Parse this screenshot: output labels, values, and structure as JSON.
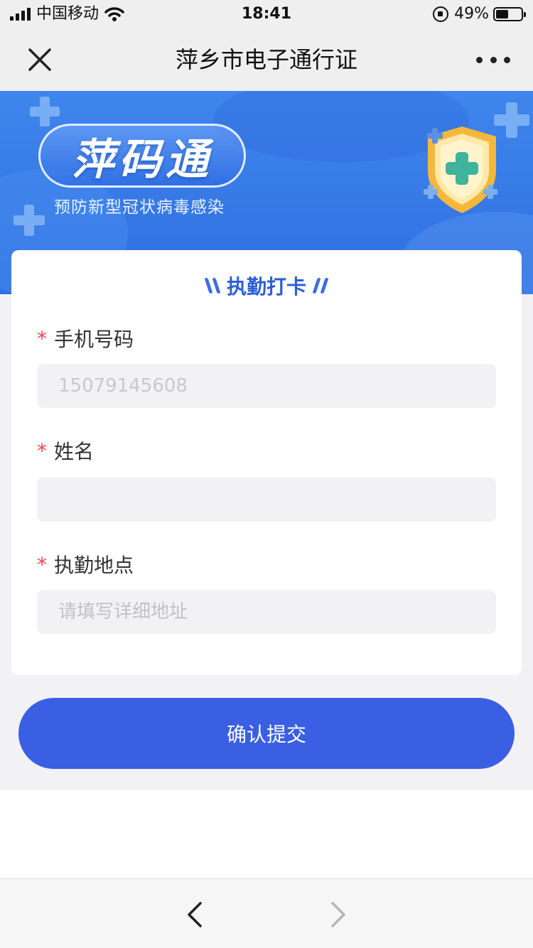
{
  "status_bar": {
    "carrier": "中国移动",
    "time": "18:41",
    "battery": "49%"
  },
  "nav": {
    "title": "萍乡市电子通行证"
  },
  "banner": {
    "brand": "萍码通",
    "subtitle": "预防新型冠状病毒感染"
  },
  "form": {
    "title": "执勤打卡",
    "required_mark": "*",
    "fields": [
      {
        "label": "手机号码",
        "value": "15079145608",
        "placeholder": ""
      },
      {
        "label": "姓名",
        "value": "",
        "placeholder": ""
      },
      {
        "label": "执勤地点",
        "value": "",
        "placeholder": "请填写详细地址"
      }
    ]
  },
  "submit_label": "确认提交",
  "colors": {
    "primary": "#3a5fe3",
    "banner": "#3f86ec",
    "title_blue": "#2d5fd6",
    "required": "#f0454a",
    "input_bg": "#f2f2f4"
  },
  "icons": [
    "close-icon",
    "more-icon",
    "shield-icon",
    "back-arrow-icon",
    "forward-arrow-icon"
  ]
}
